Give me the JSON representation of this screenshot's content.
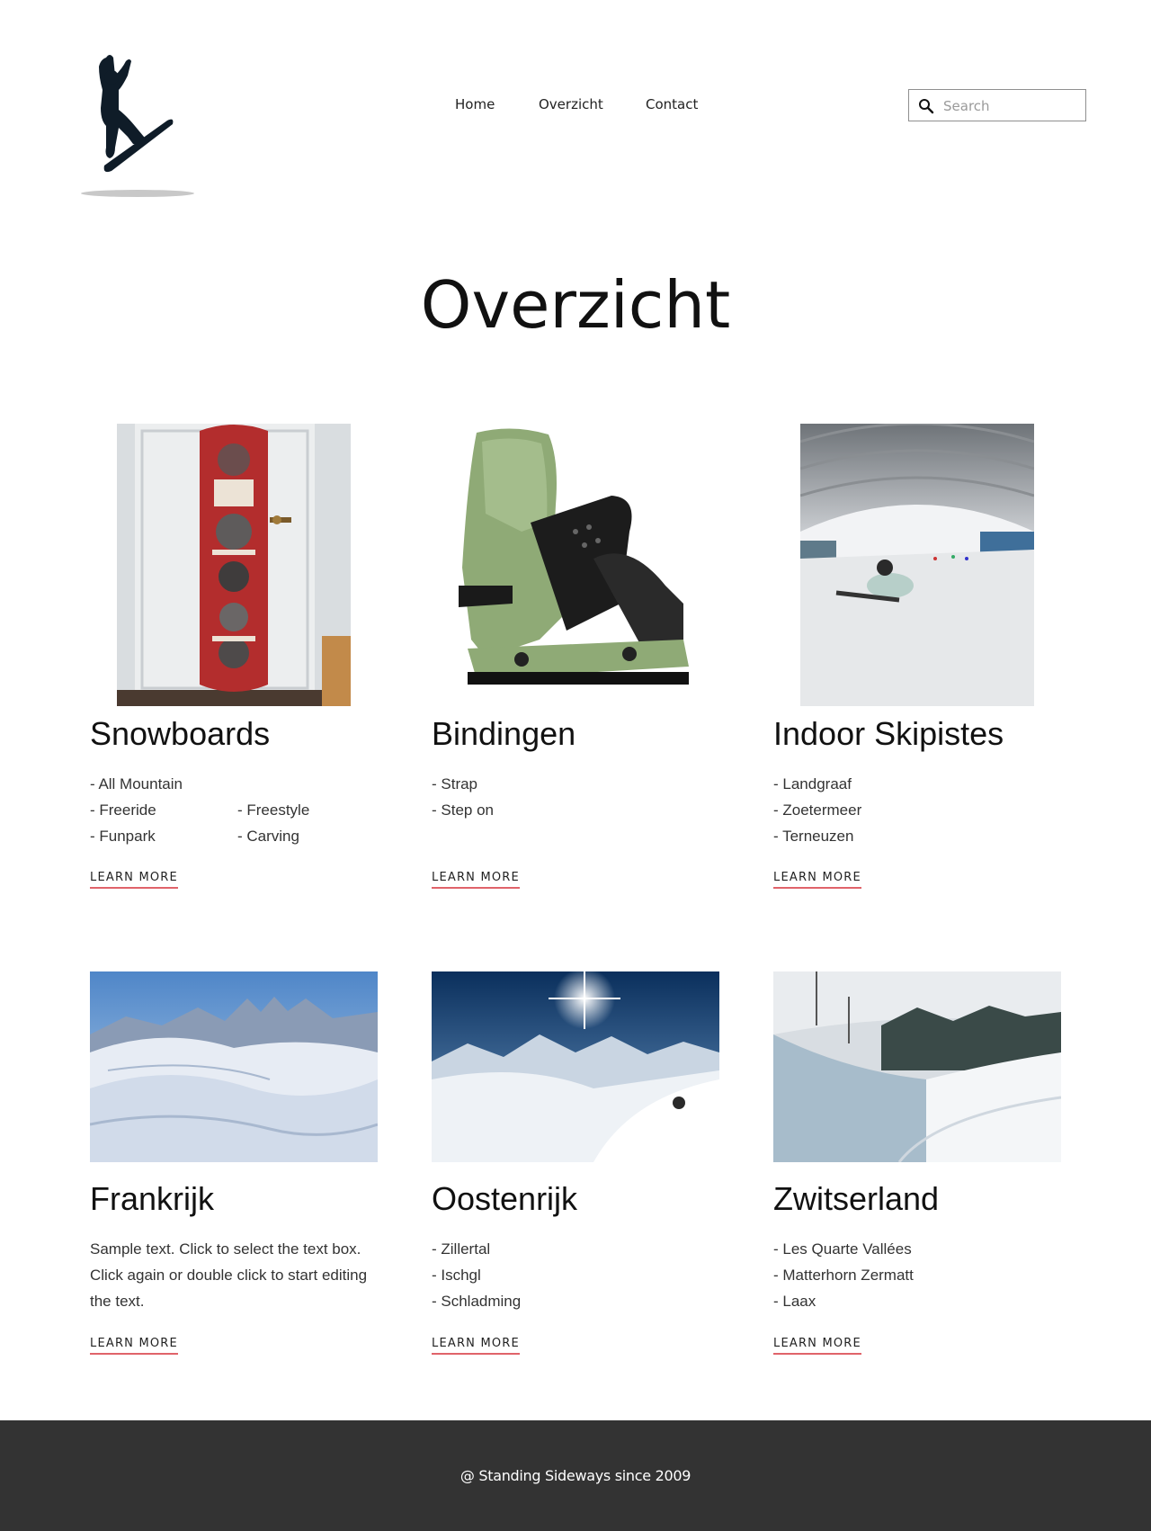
{
  "header": {
    "nav": [
      "Home",
      "Overzicht",
      "Contact"
    ],
    "search_placeholder": "Search"
  },
  "page": {
    "title": "Overzicht"
  },
  "cards": [
    {
      "title": "Snowboards",
      "items": [
        "- All Mountain",
        "- Freeride",
        "- Freestyle",
        "- Funpark",
        "- Carving"
      ],
      "cta": "LEARN MORE"
    },
    {
      "title": "Bindingen",
      "items": [
        "- Strap",
        "- Step on"
      ],
      "cta": "LEARN MORE"
    },
    {
      "title": "Indoor Skipistes",
      "items": [
        "- Landgraaf",
        "- Zoetermeer",
        "- Terneuzen"
      ],
      "cta": "LEARN MORE"
    },
    {
      "title": "Frankrijk",
      "text": "Sample text. Click to select the text box. Click again or double click to start editing the text.",
      "cta": "LEARN MORE"
    },
    {
      "title": "Oostenrijk",
      "items": [
        "- Zillertal",
        "- Ischgl",
        "- Schladming"
      ],
      "cta": "LEARN MORE"
    },
    {
      "title": "Zwitserland",
      "items": [
        "- Les Quarte Vallées",
        "- Matterhorn Zermatt",
        "- Laax"
      ],
      "cta": "LEARN MORE"
    }
  ],
  "footer": {
    "text": "@ Standing Sideways since 2009"
  },
  "colors": {
    "accent_underline": "#e0636a",
    "footer_bg": "#333333"
  },
  "icons": {
    "logo": "snowboarder-logo-icon",
    "search": "search-icon"
  }
}
